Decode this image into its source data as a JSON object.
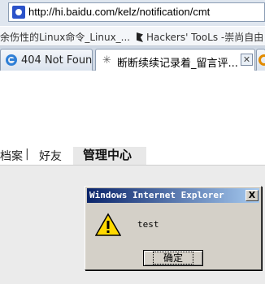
{
  "address_bar": {
    "url": "http://hi.baidu.com/kelz/notification/cmt",
    "icon": "baidu-favicon"
  },
  "favorites": [
    {
      "label": "余伤性的Linux命令_Linux_...",
      "icon": "page-icon"
    },
    {
      "label": "Hackers' TooLs -崇尚自由 !",
      "icon": "flag-icon"
    }
  ],
  "tabs": [
    {
      "label": "404 Not Found",
      "icon": "ie-icon"
    },
    {
      "label": "断断续续记录着_留言评...",
      "icon": "loading-icon",
      "active": true
    },
    {
      "label": "",
      "icon": "ie-icon"
    }
  ],
  "page": {
    "nav_items": [
      "档案",
      "好友"
    ],
    "separator": "|",
    "active_nav": "管理中心"
  },
  "dialog": {
    "title": "Windows Internet Explorer",
    "message": "test",
    "ok_label": "确定",
    "close_glyph": "X",
    "icon": "warning-icon"
  },
  "colors": {
    "titlebar_start": "#0a246a",
    "titlebar_end": "#a6caf0",
    "dialog_bg": "#d4d0c8"
  }
}
